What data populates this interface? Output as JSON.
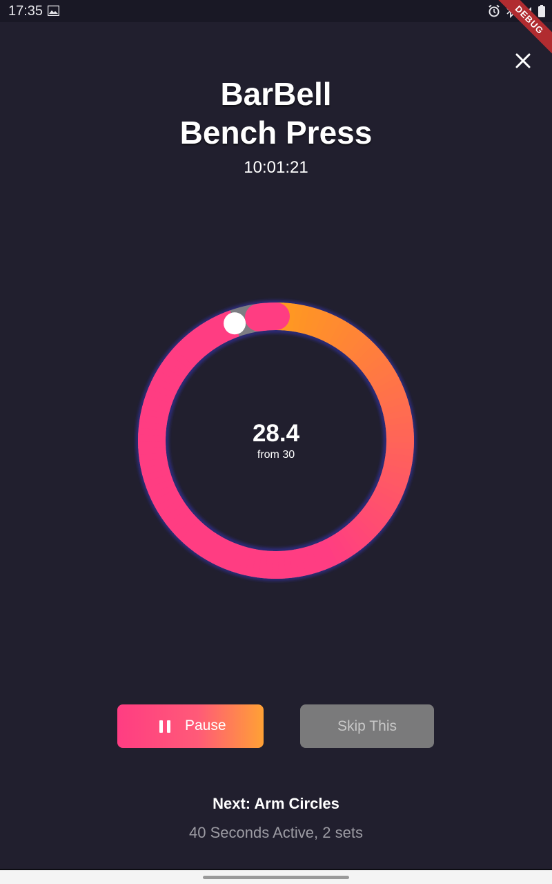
{
  "status_bar": {
    "time": "17:35",
    "left_icons": [
      "image-icon"
    ],
    "right_icons": [
      "alarm-icon",
      "bluetooth-icon",
      "signal-icon",
      "battery-icon"
    ]
  },
  "debug_banner": "DEBUG",
  "header": {
    "close_icon": "close-icon",
    "title_line1": "BarBell",
    "title_line2": "Bench Press",
    "clock": "10:01:21"
  },
  "timer_ring": {
    "value": "28.4",
    "subtitle": "from 30",
    "progress_fraction": 0.946,
    "colors": {
      "pink": "#ff3d82",
      "orange": "#ff9a1f",
      "track": "#7d7d83",
      "glow": "#3b3ad6",
      "knob": "#ffffff"
    }
  },
  "controls": {
    "pause_label": "Pause",
    "pause_icon": "pause-icon",
    "skip_label": "Skip This"
  },
  "next_exercise": {
    "title": "Next: Arm Circles",
    "details": "40 Seconds Active, 2 sets"
  }
}
